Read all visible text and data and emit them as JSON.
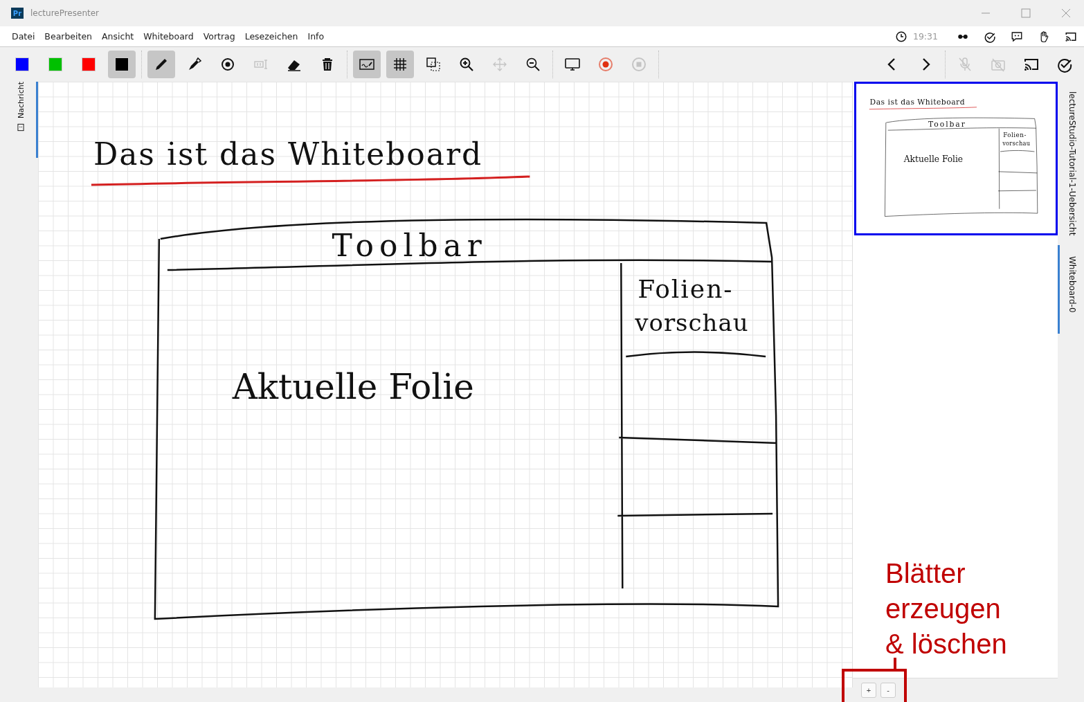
{
  "window": {
    "title": "lecturePresenter",
    "app_icon": "Pr"
  },
  "menu": [
    "Datei",
    "Bearbeiten",
    "Ansicht",
    "Whiteboard",
    "Vortrag",
    "Lesezeichen",
    "Info"
  ],
  "status": {
    "time": "19:31"
  },
  "toolbar": {
    "left": [
      [
        {
          "kind": "color",
          "color": "#0000ff",
          "selected": false
        },
        {
          "kind": "color",
          "color": "#00c000",
          "selected": false
        },
        {
          "kind": "color",
          "color": "#ff0000",
          "selected": false
        },
        {
          "kind": "color",
          "color": "#000000",
          "selected": true
        }
      ],
      [
        {
          "kind": "tool",
          "selected": true,
          "disabled": false
        },
        {
          "kind": "tool",
          "selected": false,
          "disabled": false
        },
        {
          "kind": "tool",
          "selected": false,
          "disabled": false
        },
        {
          "kind": "tool",
          "selected": false,
          "disabled": true
        },
        {
          "kind": "tool",
          "selected": false,
          "disabled": false
        },
        {
          "kind": "tool",
          "selected": false,
          "disabled": false
        }
      ],
      [
        {
          "kind": "tool",
          "selected": true,
          "disabled": false
        },
        {
          "kind": "tool",
          "selected": true,
          "disabled": false
        },
        {
          "kind": "tool",
          "selected": false,
          "disabled": false
        },
        {
          "kind": "tool",
          "selected": false,
          "disabled": false
        },
        {
          "kind": "tool",
          "selected": false,
          "disabled": true
        },
        {
          "kind": "tool",
          "selected": false,
          "disabled": false
        }
      ],
      [
        {
          "kind": "tool",
          "selected": false,
          "disabled": false
        },
        {
          "kind": "tool",
          "selected": false,
          "disabled": false
        },
        {
          "kind": "tool",
          "selected": false,
          "disabled": true
        }
      ]
    ],
    "right": [
      [
        {
          "kind": "tool",
          "disabled": false
        },
        {
          "kind": "tool",
          "disabled": false
        }
      ],
      [
        {
          "kind": "tool",
          "disabled": true
        },
        {
          "kind": "tool",
          "disabled": true
        },
        {
          "kind": "tool",
          "disabled": false
        },
        {
          "kind": "tool",
          "disabled": false
        }
      ]
    ]
  },
  "left_tabs": [
    {
      "label": "Nachricht",
      "selected": true
    }
  ],
  "whiteboard": {
    "texts": [
      "Das ist das Whiteboard",
      "Toolbar",
      "Folien-",
      "vorschau",
      "Aktuelle Folie"
    ]
  },
  "thumbnail": {
    "selected": true,
    "texts": [
      "Das ist das Whiteboard",
      "Toolbar",
      "Folien-",
      "vorschau",
      "Aktuelle Folie"
    ]
  },
  "page_buttons": [
    "+",
    "-"
  ],
  "right_tabs": [
    {
      "label": "lectureStudio-Tutorial-1-Uebersicht",
      "selected": false
    },
    {
      "label": "Whiteboard-0",
      "selected": true
    }
  ],
  "callout": {
    "text": "Blätter erzeugen & löschen"
  }
}
